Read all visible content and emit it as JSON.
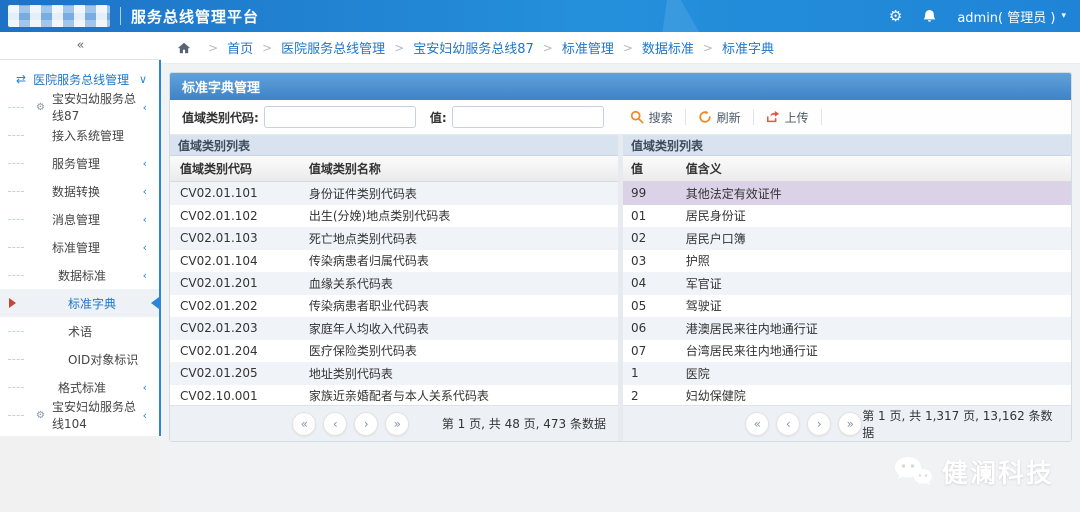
{
  "colors": {
    "accent": "#2489dc",
    "panel_header": "#4a8ecd",
    "selected_row_highlight": "#dcd2e8",
    "link": "#2077c8",
    "search_icon": "#f08a24",
    "upload_icon": "#e2574c"
  },
  "topbar": {
    "title": "服务总线管理平台",
    "user_label": "admin( 管理员 )",
    "user_caret": "▾",
    "gear_glyph": "⚙"
  },
  "sidebar": {
    "collapse_glyph": "«",
    "items": [
      {
        "label": "医院服务总线管理",
        "icon": "⇄",
        "chevron": "∨",
        "classes": [
          "lvl1"
        ]
      },
      {
        "label": "宝安妇幼服务总线87",
        "icon": "⚙",
        "chevron": "‹",
        "classes": [
          "lvl2"
        ]
      },
      {
        "label": "接入系统管理",
        "icon": "",
        "chevron": "",
        "classes": [
          "lvl3"
        ]
      },
      {
        "label": "服务管理",
        "icon": "",
        "chevron": "‹",
        "classes": [
          "lvl3"
        ]
      },
      {
        "label": "数据转换",
        "icon": "",
        "chevron": "‹",
        "classes": [
          "lvl3"
        ]
      },
      {
        "label": "消息管理",
        "icon": "",
        "chevron": "‹",
        "classes": [
          "lvl3"
        ]
      },
      {
        "label": "标准管理",
        "icon": "",
        "chevron": "‹",
        "classes": [
          "lvl3"
        ]
      },
      {
        "label": "数据标准",
        "icon": "",
        "chevron": "‹",
        "classes": [
          "lvl4"
        ]
      },
      {
        "label": "标准字典",
        "icon": "",
        "chevron": "",
        "classes": [
          "lvl5",
          "selected"
        ]
      },
      {
        "label": "术语",
        "icon": "",
        "chevron": "",
        "classes": [
          "lvl5"
        ]
      },
      {
        "label": "OID对象标识",
        "icon": "",
        "chevron": "",
        "classes": [
          "lvl5"
        ]
      },
      {
        "label": "格式标准",
        "icon": "",
        "chevron": "‹",
        "classes": [
          "lvl4"
        ]
      },
      {
        "label": "宝安妇幼服务总线104",
        "icon": "⚙",
        "chevron": "‹",
        "classes": [
          "lvl2"
        ]
      }
    ]
  },
  "breadcrumb": {
    "items": [
      {
        "label": "首页"
      },
      {
        "label": "医院服务总线管理"
      },
      {
        "label": "宝安妇幼服务总线87"
      },
      {
        "label": "标准管理"
      },
      {
        "label": "数据标准"
      },
      {
        "label": "标准字典"
      }
    ]
  },
  "panel": {
    "title": "标准字典管理",
    "search": {
      "code_label": "值域类别代码:",
      "code_value": "",
      "value_label": "值:",
      "value_value": "",
      "search_label": "搜索",
      "refresh_label": "刷新",
      "upload_label": "上传"
    },
    "pager_buttons": [
      {
        "glyph": "«"
      },
      {
        "glyph": "‹"
      },
      {
        "glyph": "›"
      },
      {
        "glyph": "»"
      }
    ],
    "left_table": {
      "group_title": "值域类别列表",
      "columns": [
        "值域类别代码",
        "值域类别名称"
      ],
      "rows": [
        [
          "CV02.01.101",
          "身份证件类别代码表"
        ],
        [
          "CV02.01.102",
          "出生(分娩)地点类别代码表"
        ],
        [
          "CV02.01.103",
          "死亡地点类别代码表"
        ],
        [
          "CV02.01.104",
          "传染病患者归属代码表"
        ],
        [
          "CV02.01.201",
          "血缘关系代码表"
        ],
        [
          "CV02.01.202",
          "传染病患者职业代码表"
        ],
        [
          "CV02.01.203",
          "家庭年人均收入代码表"
        ],
        [
          "CV02.01.204",
          "医疗保险类别代码表"
        ],
        [
          "CV02.01.205",
          "地址类别代码表"
        ],
        [
          "CV02.10.001",
          "家族近亲婚配者与本人关系代码表"
        ]
      ],
      "page_info": "第 1 页, 共 48 页,  473 条数据"
    },
    "right_table": {
      "group_title": "值域类别列表",
      "columns": [
        "值",
        "值含义"
      ],
      "highlight_index": 0,
      "rows": [
        [
          "99",
          "其他法定有效证件"
        ],
        [
          "01",
          "居民身份证"
        ],
        [
          "02",
          "居民户口簿"
        ],
        [
          "03",
          "护照"
        ],
        [
          "04",
          "军官证"
        ],
        [
          "05",
          "驾驶证"
        ],
        [
          "06",
          "港澳居民来往内地通行证"
        ],
        [
          "07",
          "台湾居民来往内地通行证"
        ],
        [
          "1",
          "医院"
        ],
        [
          "2",
          "妇幼保健院"
        ]
      ],
      "page_info": "第 1 页, 共 1,317 页,  13,162 条数据"
    }
  },
  "watermark": {
    "company": "健澜科技"
  }
}
